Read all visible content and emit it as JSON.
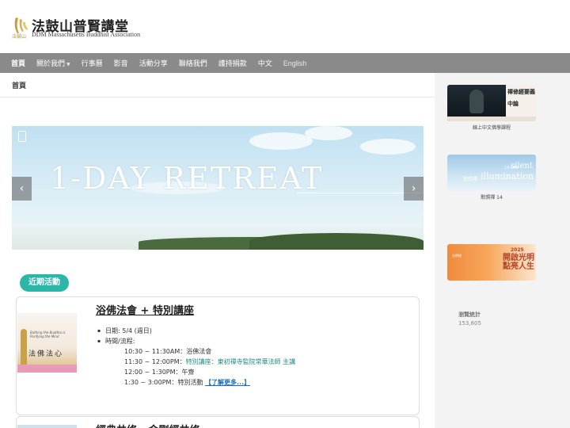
{
  "header": {
    "logo_cn": "法鼓山普賢講堂",
    "logo_en": "DDM Massachusetts Buddhist Association",
    "logo_sub": "法鼓山"
  },
  "nav": {
    "items": [
      {
        "label": "首頁"
      },
      {
        "label": "關於我們"
      },
      {
        "label": "行事曆"
      },
      {
        "label": "影音"
      },
      {
        "label": "活動分享"
      },
      {
        "label": "聯絡我們"
      },
      {
        "label": "護持捐款"
      },
      {
        "label": "中文"
      },
      {
        "label": "English"
      }
    ]
  },
  "breadcrumb": "首頁",
  "banner": {
    "title": "1-DAY RETREAT"
  },
  "recent": {
    "label": "近期活動"
  },
  "event1": {
    "title": "浴佛法會 + 特別講座",
    "date": "日期: 5/4 (週日)",
    "time_label": "時間/流程:",
    "s1_time": "10:30 ~ 11:30AM：",
    "s1_text": "浴佛法會",
    "s2_time": "11:30 ~ 12:00PM：",
    "s2_text": "特別講座：東初禪寺監院常華法師 主講",
    "s3_time": "12:00 ~ 1:30PM：",
    "s3_text": "午齋",
    "s4_time": "1:30 ~ 3:00PM：",
    "s4_text": "特別活動",
    "more": "【了解更多...】",
    "img_cn": "法佛法心",
    "img_en": "Bathing the Buddha is Purifying the Mind"
  },
  "event2": {
    "title": "經典共修 - 金剛經共修"
  },
  "sidebar": {
    "card1_t1": "禪修經要義",
    "card1_t2": "中論",
    "card1_caption": "線上中文佛學課程",
    "card2_silent": "silent",
    "card2_illum": "illumination",
    "card2_day": "14-DAY",
    "card2_cn": "默照禪",
    "card2_caption": "默照禪 14",
    "card3_year": "2025",
    "card3_big": "開啟光明 點亮人生",
    "card3_small": "光明燈",
    "stats_title": "瀏覽統計",
    "stats_value": "153,605"
  },
  "colors": {
    "nav_bg": "#8a8a8a",
    "accent_teal": "#2bb7a8",
    "link_blue": "#1a6fb5"
  },
  "icons": {
    "prev": "chevron-left-icon",
    "next": "chevron-right-icon"
  }
}
